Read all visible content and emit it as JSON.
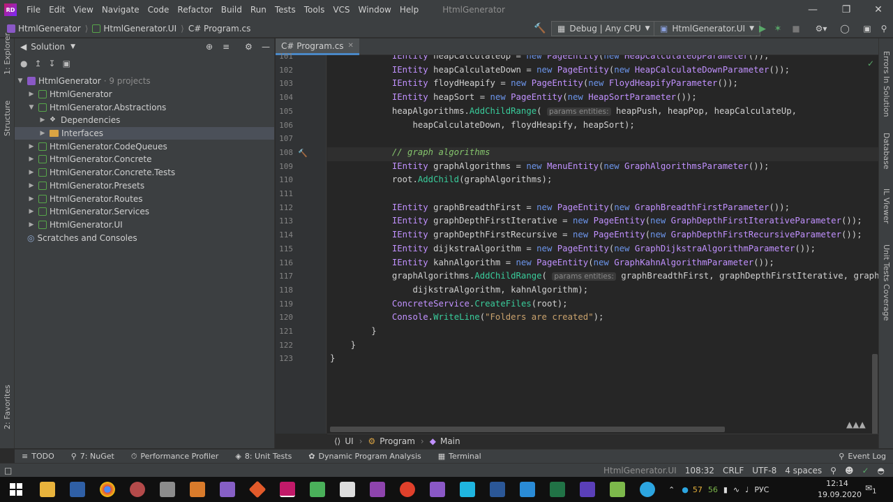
{
  "app": {
    "logo_text": "RD",
    "title": "HtmlGenerator",
    "menu": [
      "File",
      "Edit",
      "View",
      "Navigate",
      "Code",
      "Refactor",
      "Build",
      "Run",
      "Tests",
      "Tools",
      "VCS",
      "Window",
      "Help"
    ]
  },
  "navbar": {
    "crumbs": [
      "HtmlGenerator",
      "HtmlGenerator.UI",
      "C# Program.cs"
    ],
    "config": "Debug | Any CPU",
    "run_target": "HtmlGenerator.UI"
  },
  "left_stripe": {
    "explorer": "1: Explorer",
    "structure": "Structure",
    "favorites": "2: Favorites"
  },
  "right_stripe": {
    "errors": "Errors In Solution",
    "database": "Database",
    "il_viewer": "IL Viewer",
    "unit_tests": "Unit Tests Coverage"
  },
  "solution": {
    "header": "Solution",
    "root": "HtmlGenerator",
    "root_note": "· 9 projects",
    "items": [
      {
        "label": "HtmlGenerator",
        "depth": 1,
        "kind": "project",
        "expanded": false
      },
      {
        "label": "HtmlGenerator.Abstractions",
        "depth": 1,
        "kind": "project",
        "expanded": true
      },
      {
        "label": "Dependencies",
        "depth": 2,
        "kind": "deps",
        "expanded": false
      },
      {
        "label": "Interfaces",
        "depth": 2,
        "kind": "folder",
        "expanded": false,
        "selected": true
      },
      {
        "label": "HtmlGenerator.CodeQueues",
        "depth": 1,
        "kind": "project",
        "expanded": false
      },
      {
        "label": "HtmlGenerator.Concrete",
        "depth": 1,
        "kind": "project",
        "expanded": false
      },
      {
        "label": "HtmlGenerator.Concrete.Tests",
        "depth": 1,
        "kind": "project",
        "expanded": false
      },
      {
        "label": "HtmlGenerator.Presets",
        "depth": 1,
        "kind": "project",
        "expanded": false
      },
      {
        "label": "HtmlGenerator.Routes",
        "depth": 1,
        "kind": "project",
        "expanded": false
      },
      {
        "label": "HtmlGenerator.Services",
        "depth": 1,
        "kind": "project",
        "expanded": false
      },
      {
        "label": "HtmlGenerator.UI",
        "depth": 1,
        "kind": "project",
        "expanded": false
      }
    ],
    "scratches": "Scratches and Consoles"
  },
  "editor": {
    "tab": "C# Program.cs",
    "lines": [
      {
        "n": "101",
        "html": "            <span class=\"ty\">IEntity</span> heapCalculateUp = <span class=\"kw\">new</span> <span class=\"ty\">PageEntity</span>(<span class=\"kw\">new</span> <span class=\"ty\">HeapCalculateUpParameter</span>());"
      },
      {
        "n": "102",
        "html": "            <span class=\"ty\">IEntity</span> heapCalculateDown = <span class=\"kw\">new</span> <span class=\"ty\">PageEntity</span>(<span class=\"kw\">new</span> <span class=\"ty\">HeapCalculateDownParameter</span>());"
      },
      {
        "n": "103",
        "html": "            <span class=\"ty\">IEntity</span> floydHeapify = <span class=\"kw\">new</span> <span class=\"ty\">PageEntity</span>(<span class=\"kw\">new</span> <span class=\"ty\">FloydHeapifyParameter</span>());"
      },
      {
        "n": "104",
        "html": "            <span class=\"ty\">IEntity</span> heapSort = <span class=\"kw\">new</span> <span class=\"ty\">PageEntity</span>(<span class=\"kw\">new</span> <span class=\"ty\">HeapSortParameter</span>());"
      },
      {
        "n": "105",
        "html": "            heapAlgorithms.<span class=\"fn\">AddChildRange</span>( <span class=\"hint\">params entities:</span> heapPush, heapPop, heapCalculateUp,"
      },
      {
        "n": "106",
        "html": "                heapCalculateDown, floydHeapify, heapSort);"
      },
      {
        "n": "107",
        "html": ""
      },
      {
        "n": "108",
        "html": "            <span class=\"cm\">// graph algorithms</span>"
      },
      {
        "n": "109",
        "html": "            <span class=\"ty\">IEntity</span> graphAlgorithms = <span class=\"kw\">new</span> <span class=\"ty\">MenuEntity</span>(<span class=\"kw\">new</span> <span class=\"ty\">GraphAlgorithmsParameter</span>());"
      },
      {
        "n": "110",
        "html": "            root.<span class=\"fn\">AddChild</span>(graphAlgorithms);"
      },
      {
        "n": "111",
        "html": ""
      },
      {
        "n": "112",
        "html": "            <span class=\"ty\">IEntity</span> graphBreadthFirst = <span class=\"kw\">new</span> <span class=\"ty\">PageEntity</span>(<span class=\"kw\">new</span> <span class=\"ty\">GraphBreadthFirstParameter</span>());"
      },
      {
        "n": "113",
        "html": "            <span class=\"ty\">IEntity</span> graphDepthFirstIterative = <span class=\"kw\">new</span> <span class=\"ty\">PageEntity</span>(<span class=\"kw\">new</span> <span class=\"ty\">GraphDepthFirstIterativeParameter</span>());"
      },
      {
        "n": "114",
        "html": "            <span class=\"ty\">IEntity</span> graphDepthFirstRecursive = <span class=\"kw\">new</span> <span class=\"ty\">PageEntity</span>(<span class=\"kw\">new</span> <span class=\"ty\">GraphDepthFirstRecursiveParameter</span>());"
      },
      {
        "n": "115",
        "html": "            <span class=\"ty\">IEntity</span> dijkstraAlgorithm = <span class=\"kw\">new</span> <span class=\"ty\">PageEntity</span>(<span class=\"kw\">new</span> <span class=\"ty\">GraphDijkstraAlgorithmParameter</span>());"
      },
      {
        "n": "116",
        "html": "            <span class=\"ty\">IEntity</span> kahnAlgorithm = <span class=\"kw\">new</span> <span class=\"ty\">PageEntity</span>(<span class=\"kw\">new</span> <span class=\"ty\">GraphKahnAlgorithmParameter</span>());"
      },
      {
        "n": "117",
        "html": "            graphAlgorithms.<span class=\"fn\">AddChildRange</span>( <span class=\"hint\">params entities:</span> graphBreadthFirst, graphDepthFirstIterative, graphD"
      },
      {
        "n": "118",
        "html": "                dijkstraAlgorithm, kahnAlgorithm);"
      },
      {
        "n": "119",
        "html": "            <span class=\"ty\">ConcreteService</span>.<span class=\"fn\">CreateFiles</span>(root);"
      },
      {
        "n": "120",
        "html": "            <span class=\"ty\">Console</span>.<span class=\"fn\">WriteLine</span>(<span class=\"st\">\"Folders are created\"</span>);"
      },
      {
        "n": "121",
        "html": "        }"
      },
      {
        "n": "122",
        "html": "    }"
      },
      {
        "n": "123",
        "html": "}"
      }
    ],
    "breadcrumb": [
      "UI",
      "Program",
      "Main"
    ]
  },
  "tool_tabs": [
    "TODO",
    "7: NuGet",
    "Performance Profiler",
    "8: Unit Tests",
    "Dynamic Program Analysis",
    "Terminal"
  ],
  "event_log": "Event Log",
  "status": {
    "project": "HtmlGenerator.UI",
    "position": "108:32",
    "line_sep": "CRLF",
    "encoding": "UTF-8",
    "indent": "4 spaces"
  },
  "taskbar": {
    "tray_a": "57",
    "tray_b": "56",
    "lang": "РУС",
    "time": "12:14",
    "date": "19.09.2020",
    "notif": "1"
  }
}
